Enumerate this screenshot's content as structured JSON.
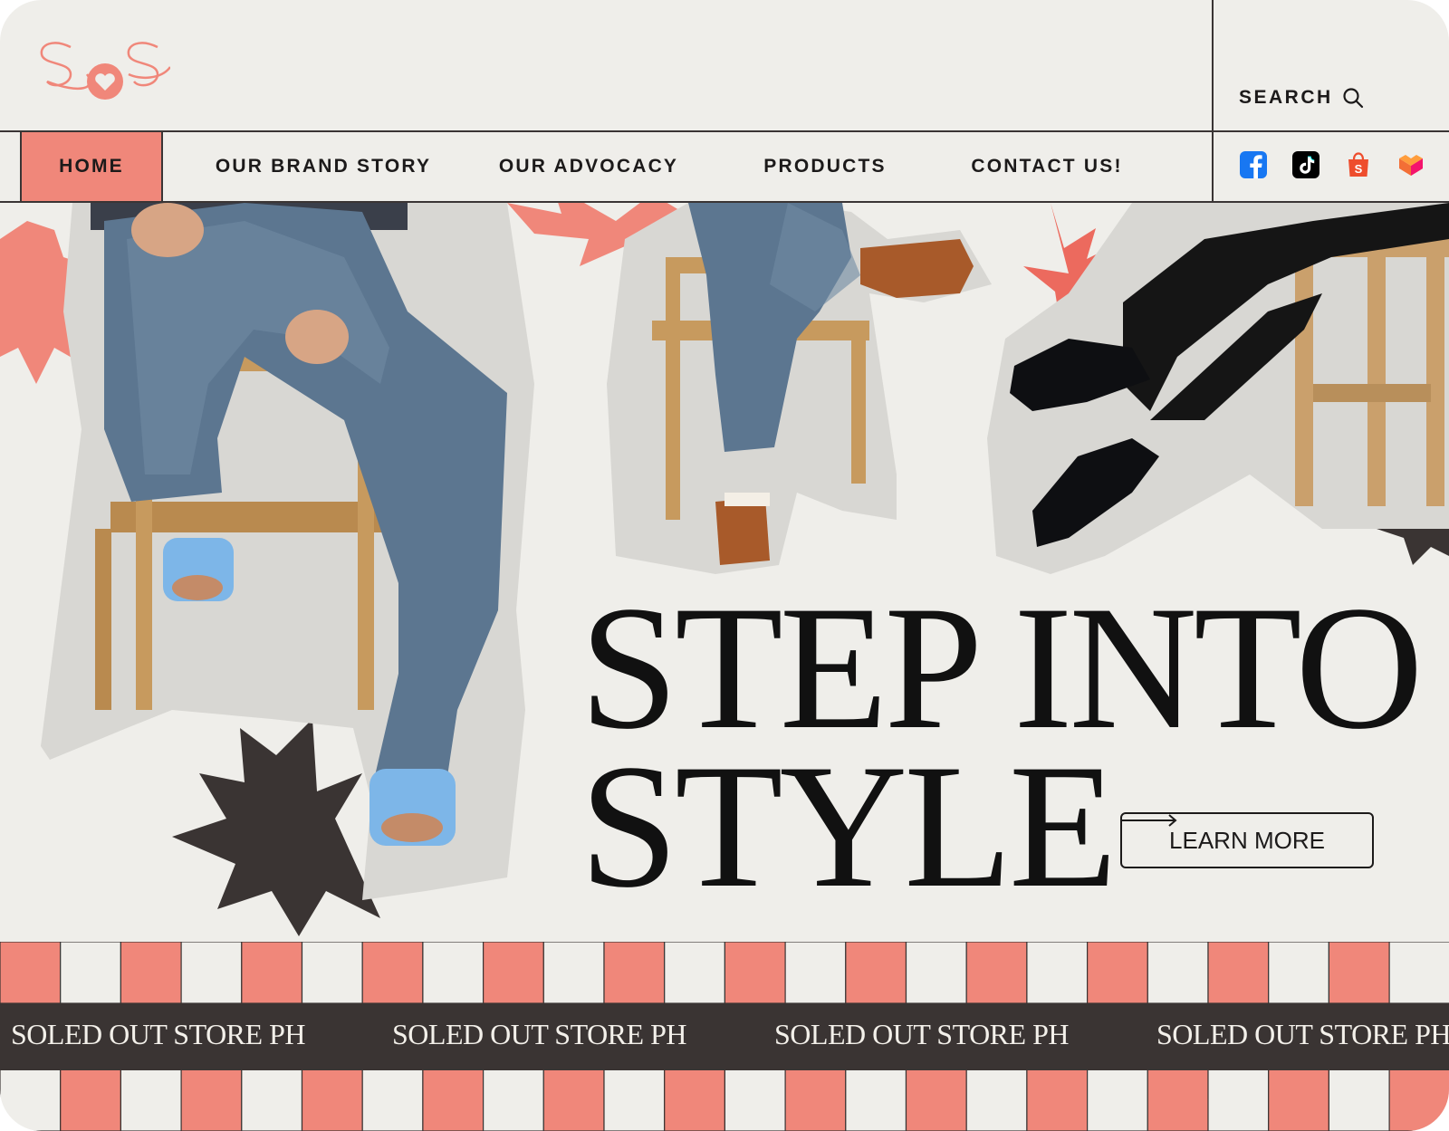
{
  "header": {
    "logo_text": "SOS",
    "search_label": "SEARCH"
  },
  "nav": {
    "items": [
      {
        "label": "HOME",
        "active": true
      },
      {
        "label": "OUR BRAND STORY",
        "active": false
      },
      {
        "label": "OUR ADVOCACY",
        "active": false
      },
      {
        "label": "PRODUCTS",
        "active": false
      },
      {
        "label": "CONTACT US!",
        "active": false
      }
    ]
  },
  "socials": [
    {
      "icon": "facebook-icon",
      "color": "#1877f2"
    },
    {
      "icon": "tiktok-icon",
      "color": "#000000"
    },
    {
      "icon": "shopee-icon",
      "color": "#ee4d2d"
    },
    {
      "icon": "lazada-icon",
      "color": "#f36f36"
    }
  ],
  "hero": {
    "headline_line1": "STEP INTO",
    "headline_line2": "STYLE",
    "cta_label": "LEARN MORE"
  },
  "banner": {
    "items": [
      "SOLED OUT  STORE PH",
      "SOLED OUT  STORE PH",
      "SOLED OUT  STORE PH",
      "SOLED OUT  STORE PH"
    ]
  },
  "colors": {
    "background": "#efeeea",
    "accent": "#f0877a",
    "dark": "#3a3433",
    "text": "#1c1a1a"
  }
}
